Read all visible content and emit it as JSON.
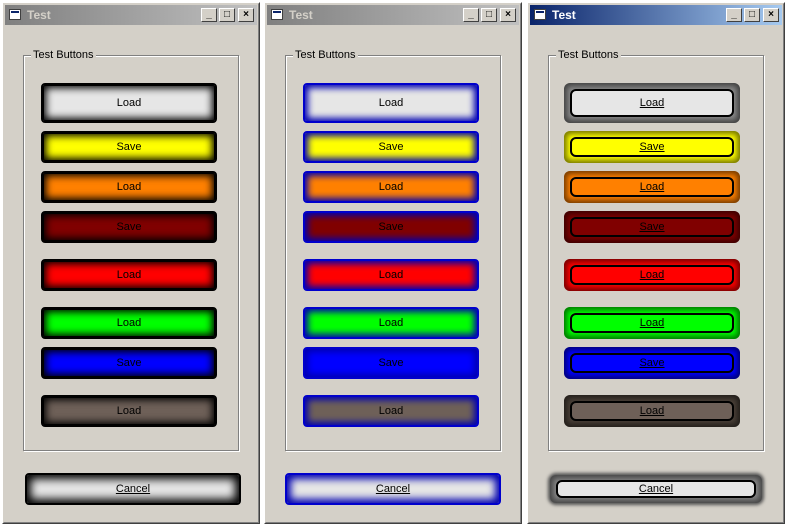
{
  "windows": [
    {
      "title": "Test",
      "active": false,
      "group_label": "Test Buttons",
      "style": "A",
      "cancel_label": "Cancel",
      "buttons": [
        {
          "label": "Load",
          "color": "#e6e6e6"
        },
        {
          "label": "Save",
          "color": "#ffff00"
        },
        {
          "label": "Load",
          "color": "#ff8000"
        },
        {
          "label": "Save",
          "color": "#800000"
        },
        {
          "label": "Load",
          "color": "#ff0000"
        },
        {
          "label": "Load",
          "color": "#00ff00"
        },
        {
          "label": "Save",
          "color": "#0000ff"
        },
        {
          "label": "Load",
          "color": "#6e6058"
        }
      ]
    },
    {
      "title": "Test",
      "active": false,
      "group_label": "Test Buttons",
      "style": "B",
      "cancel_label": "Cancel",
      "buttons": [
        {
          "label": "Load",
          "color": "#e6e6e6"
        },
        {
          "label": "Save",
          "color": "#ffff00"
        },
        {
          "label": "Load",
          "color": "#ff8000"
        },
        {
          "label": "Save",
          "color": "#800000"
        },
        {
          "label": "Load",
          "color": "#ff0000"
        },
        {
          "label": "Load",
          "color": "#00ff00"
        },
        {
          "label": "Save",
          "color": "#0000ff"
        },
        {
          "label": "Load",
          "color": "#6e6058"
        }
      ]
    },
    {
      "title": "Test",
      "active": true,
      "group_label": "Test Buttons",
      "style": "C",
      "cancel_label": "Cancel",
      "buttons": [
        {
          "label": "Load",
          "color": "#e6e6e6"
        },
        {
          "label": "Save",
          "color": "#ffff00"
        },
        {
          "label": "Load",
          "color": "#ff8000"
        },
        {
          "label": "Save",
          "color": "#800000"
        },
        {
          "label": "Load",
          "color": "#ff0000"
        },
        {
          "label": "Load",
          "color": "#00ff00"
        },
        {
          "label": "Save",
          "color": "#0000ff"
        },
        {
          "label": "Load",
          "color": "#6e6058"
        }
      ]
    }
  ],
  "titlebar_buttons": {
    "minimize": "_",
    "maximize": "□",
    "close": "×"
  }
}
